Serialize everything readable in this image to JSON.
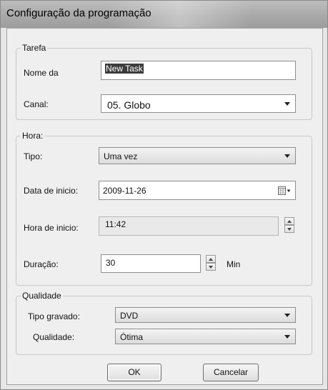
{
  "window": {
    "title": "Configuração da programação"
  },
  "tarefa": {
    "group_label": "Tarefa",
    "name_label": "Nome da",
    "name_value": "New Task",
    "channel_label": "Canal:",
    "channel_value": "05. Globo"
  },
  "hora": {
    "group_label": "Hora:",
    "type_label": "Tipo:",
    "type_value": "Uma vez",
    "date_label": "Data de inicio:",
    "date_value": "2009-11-26",
    "time_label": "Hora de inicio:",
    "time_value": "11:42",
    "duration_label": "Duração:",
    "duration_value": "30",
    "duration_unit": "Min"
  },
  "qualidade": {
    "group_label": "Qualidade",
    "record_type_label": "Tipo gravado:",
    "record_type_value": "DVD",
    "quality_label": "Qualidade:",
    "quality_value": "Ótima"
  },
  "buttons": {
    "ok": "OK",
    "cancel": "Cancelar"
  }
}
